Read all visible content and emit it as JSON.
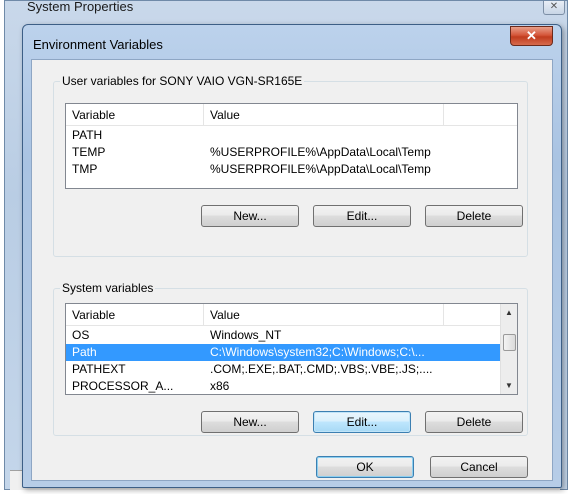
{
  "background_window": {
    "title": "System Properties",
    "close_glyph": "✕"
  },
  "dialog": {
    "title": "Environment Variables",
    "close_glyph": "✕"
  },
  "user_vars": {
    "group_label": "User variables for SONY VAIO VGN-SR165E",
    "columns": [
      "Variable",
      "Value"
    ],
    "rows": [
      {
        "variable": "PATH",
        "value": ""
      },
      {
        "variable": "TEMP",
        "value": "%USERPROFILE%\\AppData\\Local\\Temp"
      },
      {
        "variable": "TMP",
        "value": "%USERPROFILE%\\AppData\\Local\\Temp"
      }
    ],
    "buttons": {
      "new": "New...",
      "edit": "Edit...",
      "delete": "Delete"
    }
  },
  "system_vars": {
    "group_label": "System variables",
    "columns": [
      "Variable",
      "Value"
    ],
    "rows": [
      {
        "variable": "OS",
        "value": "Windows_NT"
      },
      {
        "variable": "Path",
        "value": "C:\\Windows\\system32;C:\\Windows;C:\\..."
      },
      {
        "variable": "PATHEXT",
        "value": ".COM;.EXE;.BAT;.CMD;.VBS;.VBE;.JS;...."
      },
      {
        "variable": "PROCESSOR_A...",
        "value": "x86"
      }
    ],
    "selected_index": 1,
    "buttons": {
      "new": "New...",
      "edit": "Edit...",
      "delete": "Delete"
    }
  },
  "footer": {
    "ok": "OK",
    "cancel": "Cancel"
  },
  "colors": {
    "selection": "#3399ff",
    "close_button": "#c13c1e"
  },
  "icons": {
    "scroll_up": "scroll-up-arrow-icon",
    "scroll_down": "scroll-down-arrow-icon"
  }
}
